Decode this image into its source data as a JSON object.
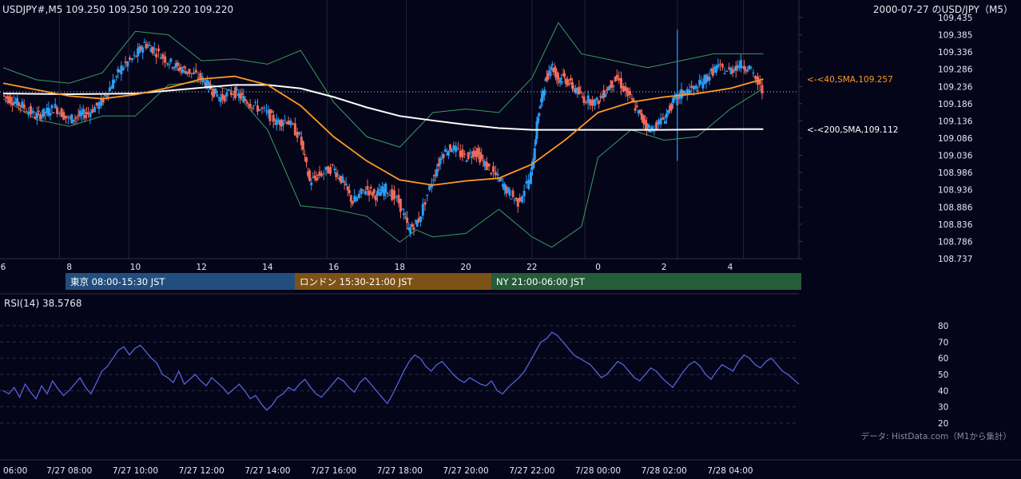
{
  "header": {
    "symbol_ohlc": "USDJPY#,M5 109.250 109.250 109.220 109.220",
    "title_right": "2000-07-27 のUSD/JPY（M5）"
  },
  "chart_data": [
    {
      "type": "candlestick",
      "symbol": "USDJPY#",
      "timeframe": "M5",
      "last_ohlc": {
        "open": 109.25,
        "high": 109.25,
        "low": 109.22,
        "close": 109.22
      },
      "x_tick_labels": [
        "6",
        "8",
        "10",
        "12",
        "14",
        "16",
        "18",
        "20",
        "22",
        "0",
        "2",
        "4"
      ],
      "x_hours": [
        6,
        8,
        10,
        12,
        14,
        16,
        18,
        20,
        22,
        24,
        26,
        28
      ],
      "y_tick_labels": [
        "109.435",
        "109.385",
        "109.336",
        "109.286",
        "109.236",
        "109.186",
        "109.136",
        "109.086",
        "109.036",
        "108.986",
        "108.936",
        "108.886",
        "108.836",
        "108.786",
        "108.737"
      ],
      "ylim": [
        108.737,
        109.435
      ],
      "grid": true,
      "current_price_line": 109.22,
      "indicators": {
        "sma40": {
          "label": "<-<40,SMA,109.257",
          "last": 109.257,
          "color": "#ff9a1f",
          "points": [
            [
              6,
              109.245
            ],
            [
              7,
              109.226
            ],
            [
              8,
              109.208
            ],
            [
              9,
              109.2
            ],
            [
              10,
              109.212
            ],
            [
              11,
              109.232
            ],
            [
              12,
              109.257
            ],
            [
              13,
              109.265
            ],
            [
              14,
              109.24
            ],
            [
              15,
              109.18
            ],
            [
              16,
              109.09
            ],
            [
              17,
              109.02
            ],
            [
              18,
              108.965
            ],
            [
              19,
              108.95
            ],
            [
              20,
              108.962
            ],
            [
              21,
              108.97
            ],
            [
              22,
              109.01
            ],
            [
              23,
              109.08
            ],
            [
              24,
              109.16
            ],
            [
              25,
              109.19
            ],
            [
              26,
              109.205
            ],
            [
              27,
              109.215
            ],
            [
              28,
              109.23
            ],
            [
              29,
              109.257
            ]
          ]
        },
        "sma200": {
          "label": "<-<200,SMA,109.112",
          "last": 109.112,
          "color": "#ffffff",
          "points": [
            [
              6,
              109.215
            ],
            [
              8,
              109.213
            ],
            [
              10,
              109.215
            ],
            [
              12,
              109.232
            ],
            [
              13,
              109.24
            ],
            [
              14,
              109.24
            ],
            [
              15,
              109.23
            ],
            [
              16,
              109.205
            ],
            [
              17,
              109.175
            ],
            [
              18,
              109.15
            ],
            [
              19,
              109.137
            ],
            [
              20,
              109.125
            ],
            [
              21,
              109.115
            ],
            [
              22,
              109.11
            ],
            [
              24,
              109.11
            ],
            [
              26,
              109.11
            ],
            [
              28,
              109.112
            ],
            [
              29,
              109.112
            ]
          ]
        },
        "bollinger": {
          "color": "#3a9a5a",
          "upper": [
            [
              6,
              109.29
            ],
            [
              7,
              109.255
            ],
            [
              8,
              109.245
            ],
            [
              9,
              109.275
            ],
            [
              10,
              109.395
            ],
            [
              11,
              109.385
            ],
            [
              12,
              109.31
            ],
            [
              13,
              109.315
            ],
            [
              14,
              109.3
            ],
            [
              15,
              109.34
            ],
            [
              16,
              109.19
            ],
            [
              17,
              109.09
            ],
            [
              18,
              109.06
            ],
            [
              19,
              109.16
            ],
            [
              20,
              109.17
            ],
            [
              21,
              109.16
            ],
            [
              22,
              109.26
            ],
            [
              22.8,
              109.42
            ],
            [
              23.5,
              109.33
            ],
            [
              24.5,
              109.31
            ],
            [
              25.5,
              109.29
            ],
            [
              26.5,
              109.31
            ],
            [
              27.5,
              109.33
            ],
            [
              28.5,
              109.33
            ],
            [
              29,
              109.33
            ]
          ],
          "lower": [
            [
              6,
              109.2
            ],
            [
              7,
              109.14
            ],
            [
              8,
              109.12
            ],
            [
              9,
              109.15
            ],
            [
              10,
              109.15
            ],
            [
              11,
              109.24
            ],
            [
              12,
              109.25
            ],
            [
              13,
              109.22
            ],
            [
              14,
              109.11
            ],
            [
              15,
              108.89
            ],
            [
              16,
              108.88
            ],
            [
              17,
              108.86
            ],
            [
              18,
              108.785
            ],
            [
              18.5,
              108.82
            ],
            [
              19,
              108.8
            ],
            [
              20,
              108.81
            ],
            [
              21,
              108.88
            ],
            [
              22,
              108.8
            ],
            [
              22.6,
              108.77
            ],
            [
              23.5,
              108.83
            ],
            [
              24,
              109.03
            ],
            [
              25,
              109.11
            ],
            [
              26,
              109.08
            ],
            [
              27,
              109.09
            ],
            [
              28,
              109.17
            ],
            [
              29,
              109.23
            ]
          ]
        }
      },
      "closes": [
        [
          6,
          109.21
        ],
        [
          6.3,
          109.195
        ],
        [
          6.6,
          109.18
        ],
        [
          7,
          109.15
        ],
        [
          7.3,
          109.16
        ],
        [
          7.6,
          109.175
        ],
        [
          8,
          109.14
        ],
        [
          8.3,
          109.15
        ],
        [
          8.6,
          109.16
        ],
        [
          9,
          109.19
        ],
        [
          9.3,
          109.24
        ],
        [
          9.6,
          109.29
        ],
        [
          10,
          109.32
        ],
        [
          10.3,
          109.36
        ],
        [
          10.6,
          109.34
        ],
        [
          11,
          109.31
        ],
        [
          11.3,
          109.29
        ],
        [
          11.6,
          109.28
        ],
        [
          12,
          109.26
        ],
        [
          12.3,
          109.23
        ],
        [
          12.6,
          109.2
        ],
        [
          13,
          109.22
        ],
        [
          13.3,
          109.2
        ],
        [
          13.6,
          109.18
        ],
        [
          14,
          109.16
        ],
        [
          14.3,
          109.13
        ],
        [
          14.6,
          109.14
        ],
        [
          15,
          109.09
        ],
        [
          15.3,
          108.96
        ],
        [
          15.6,
          108.98
        ],
        [
          16,
          109.0
        ],
        [
          16.3,
          108.96
        ],
        [
          16.6,
          108.9
        ],
        [
          17,
          108.94
        ],
        [
          17.3,
          108.92
        ],
        [
          17.6,
          108.94
        ],
        [
          18,
          108.9
        ],
        [
          18.3,
          108.82
        ],
        [
          18.6,
          108.85
        ],
        [
          19,
          108.96
        ],
        [
          19.3,
          109.04
        ],
        [
          19.6,
          109.06
        ],
        [
          20,
          109.03
        ],
        [
          20.3,
          109.05
        ],
        [
          20.6,
          109.01
        ],
        [
          21,
          108.97
        ],
        [
          21.3,
          108.93
        ],
        [
          21.6,
          108.9
        ],
        [
          22,
          108.98
        ],
        [
          22.2,
          109.15
        ],
        [
          22.4,
          109.24
        ],
        [
          22.6,
          109.3
        ],
        [
          22.8,
          109.26
        ],
        [
          23,
          109.26
        ],
        [
          23.3,
          109.23
        ],
        [
          23.6,
          109.2
        ],
        [
          24,
          109.19
        ],
        [
          24.3,
          109.23
        ],
        [
          24.6,
          109.26
        ],
        [
          25,
          109.2
        ],
        [
          25.3,
          109.15
        ],
        [
          25.6,
          109.11
        ],
        [
          26,
          109.14
        ],
        [
          26.3,
          109.19
        ],
        [
          26.6,
          109.22
        ],
        [
          27,
          109.23
        ],
        [
          27.3,
          109.26
        ],
        [
          27.6,
          109.29
        ],
        [
          28,
          109.28
        ],
        [
          28.3,
          109.3
        ],
        [
          28.6,
          109.29
        ],
        [
          29,
          109.22
        ]
      ],
      "blue_spike": {
        "x": 26.4,
        "high": 109.4,
        "low": 109.02
      },
      "x_grid_hours": [
        7.7,
        9.8,
        15.8,
        18.2,
        22.0,
        23.6,
        26.4,
        28.4
      ]
    },
    {
      "type": "line",
      "label": "RSI(14) 38.5768",
      "series_color": "#5a6ae6",
      "y_tick_labels": [
        "80",
        "70",
        "60",
        "50",
        "40",
        "30",
        "20"
      ],
      "ylim": [
        20,
        80
      ],
      "values": [
        40,
        38,
        42,
        36,
        44,
        39,
        35,
        43,
        38,
        46,
        41,
        37,
        40,
        44,
        48,
        42,
        38,
        45,
        52,
        55,
        60,
        65,
        67,
        62,
        66,
        68,
        64,
        60,
        57,
        50,
        48,
        45,
        52,
        44,
        47,
        50,
        46,
        43,
        48,
        45,
        42,
        38,
        41,
        44,
        40,
        35,
        37,
        32,
        28,
        31,
        36,
        38,
        42,
        40,
        44,
        47,
        42,
        38,
        36,
        40,
        44,
        48,
        46,
        42,
        39,
        45,
        48,
        44,
        40,
        36,
        32,
        38,
        45,
        52,
        58,
        62,
        60,
        55,
        52,
        56,
        58,
        54,
        50,
        47,
        45,
        48,
        46,
        44,
        43,
        46,
        40,
        38,
        42,
        45,
        48,
        52,
        58,
        64,
        70,
        72,
        76,
        74,
        70,
        66,
        62,
        60,
        58,
        56,
        52,
        48,
        50,
        54,
        58,
        56,
        52,
        48,
        46,
        50,
        54,
        52,
        48,
        45,
        42,
        47,
        52,
        56,
        58,
        55,
        50,
        47,
        52,
        56,
        54,
        52,
        58,
        62,
        60,
        56,
        54,
        58,
        60,
        56,
        52,
        50,
        47,
        44
      ]
    }
  ],
  "x_axis_bottom": [
    "06:00",
    "7/27 08:00",
    "7/27 10:00",
    "7/27 12:00",
    "7/27 14:00",
    "7/27 16:00",
    "7/27 18:00",
    "7/27 20:00",
    "7/27 22:00",
    "7/28 00:00",
    "7/28 02:00",
    "7/28 04:00"
  ],
  "sessions": [
    {
      "label": "東京 08:00-15:30 JST",
      "color": "#214e7f"
    },
    {
      "label": "ロンドン 15:30-21:00 JST",
      "color": "#7d5216"
    },
    {
      "label": "NY 21:00-06:00 JST",
      "color": "#255c3a"
    }
  ],
  "source_note": "データ: HistData.com（M1から集計）"
}
